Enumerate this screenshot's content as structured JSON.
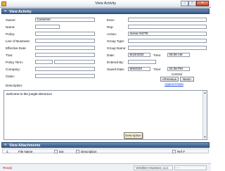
{
  "window": {
    "title": "View Activity",
    "min_label": "–",
    "max_label": "□",
    "close_label": "×"
  },
  "activity_section": {
    "title": "View Activity",
    "chevron": "«"
  },
  "left_fields": [
    {
      "label": "Owner:",
      "value": "Customer"
    },
    {
      "label": "Name:",
      "value": ""
    },
    {
      "label": "Policy:",
      "value": ""
    },
    {
      "label": "Line of Business:",
      "value": ""
    },
    {
      "label": "Effective Date:",
      "value": ""
    },
    {
      "label": "Tran:",
      "value": ""
    },
    {
      "label": "Policy Term:",
      "value": ""
    },
    {
      "label": "Company:",
      "value": ""
    },
    {
      "label": "Claim:",
      "value": ""
    }
  ],
  "right_fields": [
    {
      "label": "Exec:",
      "value": ""
    },
    {
      "label": "Rep:",
      "value": ""
    },
    {
      "label": "Action:",
      "value": "Insear NOTE"
    },
    {
      "label": "Group Type:",
      "value": ""
    },
    {
      "label": "Group Name:",
      "value": ""
    }
  ],
  "date_row": {
    "label": "Date:",
    "value": "8/10/2020",
    "time_label": "Time:",
    "time_value": "05:08 AM"
  },
  "entered_by": {
    "label": "Entered By:",
    "value": ""
  },
  "saved_row": {
    "label": "Saved Date:",
    "value": "8/9/2020",
    "time_label": "Time:",
    "time_value": "04:38 PM"
  },
  "central_label": "Central",
  "nav": {
    "previous": "<Previous",
    "next": "Next>"
  },
  "append_link": "Append Data",
  "description": {
    "label": "Description:",
    "text": "welcome to the jungle-demo114",
    "tooltip": "Description",
    "scroll_up": "▲",
    "scroll_down": "▼"
  },
  "attachments_section": {
    "title": "View Attachments",
    "chevron": "«"
  },
  "attachments_row": {
    "index": "1.",
    "file_name": "File Name",
    "ext": "Ext",
    "description": "Description",
    "ref": "Ref #"
  },
  "status": {
    "ready": "Ready",
    "company": "Vertafore Insurance, LLC",
    "extra": "—"
  }
}
